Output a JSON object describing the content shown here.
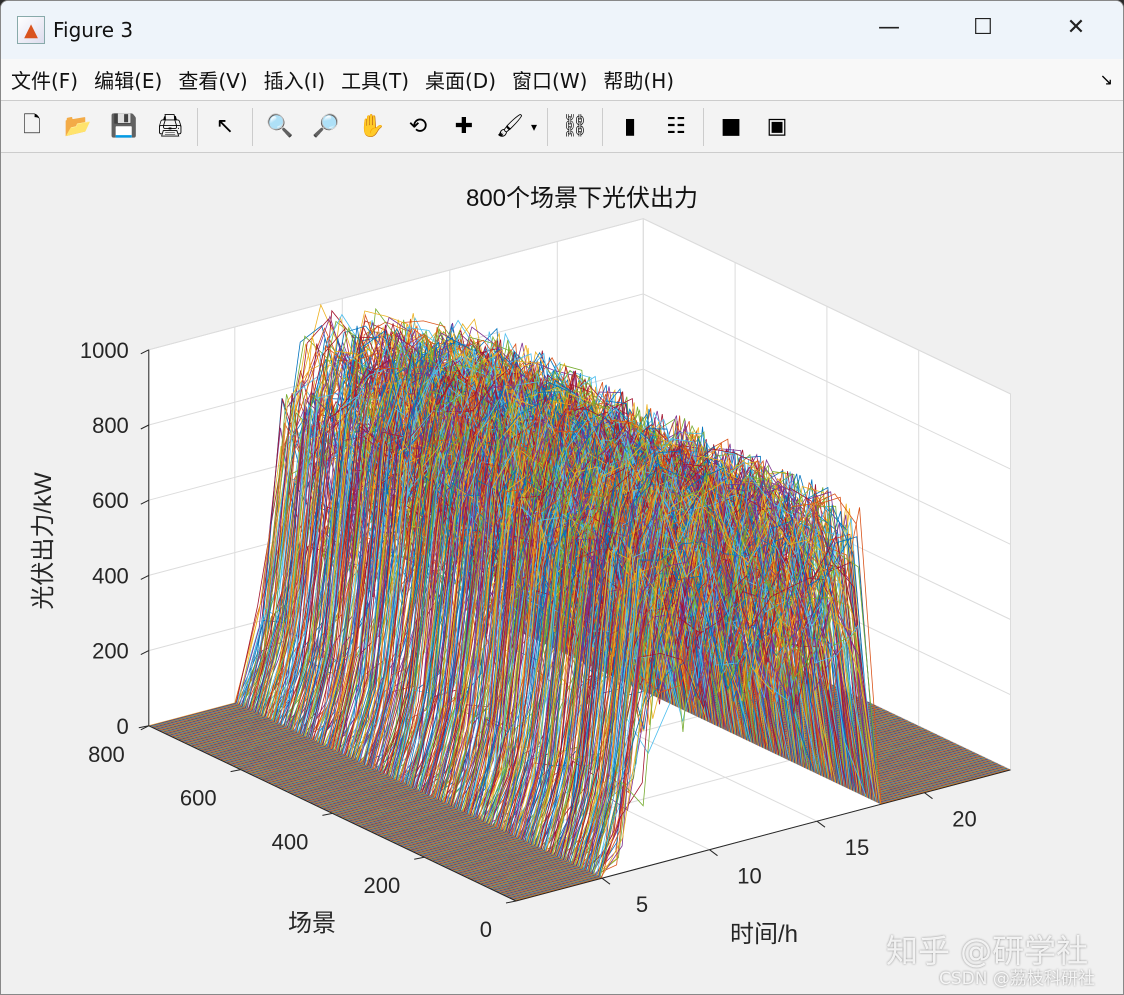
{
  "window": {
    "title": "Figure 3",
    "icon": "matlab-logo-icon",
    "controls": [
      "minimize-icon",
      "maximize-icon",
      "close-icon"
    ]
  },
  "menu": [
    "文件(F)",
    "编辑(E)",
    "查看(V)",
    "插入(I)",
    "工具(T)",
    "桌面(D)",
    "窗口(W)",
    "帮助(H)"
  ],
  "toolbar": [
    "new-figure-icon",
    "open-icon",
    "save-icon",
    "print-icon",
    "|",
    "pointer-icon",
    "|",
    "zoom-in-icon",
    "zoom-out-icon",
    "pan-icon",
    "rotate-3d-icon",
    "data-cursor-icon",
    "brush-icon",
    "brush-dropdown-icon",
    "|",
    "link-plot-icon",
    "|",
    "colorbar-icon",
    "legend-icon",
    "|",
    "hide-plot-tools-icon",
    "show-plot-tools-icon"
  ],
  "watermarks": [
    "知乎 @研学社",
    "CSDN @荔枝科研社"
  ],
  "chart_data": {
    "type": "line",
    "subtype": "3d-lines (plot3)",
    "title": "800个场景下光伏出力",
    "xlabel": "时间/h",
    "ylabel": "场景",
    "zlabel": "光伏出力/kW",
    "xlim": [
      1,
      24
    ],
    "ylim": [
      0,
      800
    ],
    "zlim": [
      0,
      1000
    ],
    "xticks": [
      5,
      10,
      15,
      20
    ],
    "yticks": [
      0,
      200,
      400,
      600,
      800
    ],
    "zticks": [
      0,
      200,
      400,
      600,
      800,
      1000
    ],
    "grid": true,
    "scenario_count": 800,
    "hours": [
      1,
      2,
      3,
      4,
      5,
      6,
      7,
      8,
      9,
      10,
      11,
      12,
      13,
      14,
      15,
      16,
      17,
      18,
      19,
      20,
      21,
      22,
      23,
      24
    ],
    "typical_max_output_kW": [
      0,
      0,
      0,
      0,
      0,
      250,
      850,
      950,
      1000,
      1000,
      980,
      960,
      930,
      900,
      880,
      860,
      820,
      0,
      0,
      0,
      0,
      0,
      0,
      0
    ],
    "typical_min_output_kW": [
      0,
      0,
      0,
      0,
      0,
      0,
      100,
      250,
      300,
      300,
      300,
      300,
      300,
      280,
      250,
      200,
      150,
      0,
      0,
      0,
      0,
      0,
      0,
      0
    ],
    "series_colors": [
      "#0072BD",
      "#D95319",
      "#EDB120",
      "#7E2F8E",
      "#77AC30",
      "#4DBEEE",
      "#A2142F"
    ]
  }
}
